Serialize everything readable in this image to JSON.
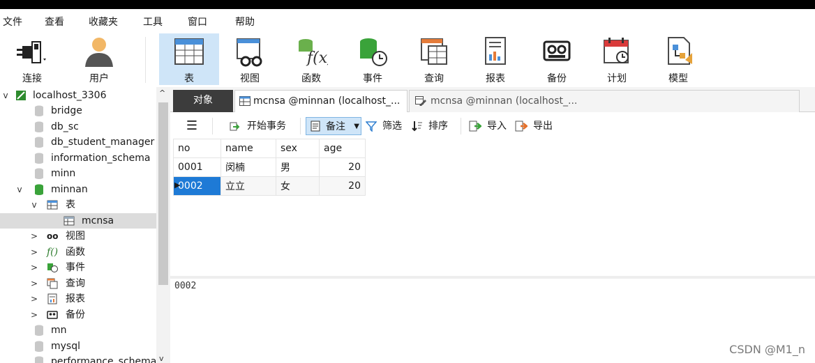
{
  "menu": [
    "文件",
    "查看",
    "收藏夹",
    "工具",
    "窗口",
    "帮助"
  ],
  "ribbon": {
    "connect": "连接",
    "user": "用户",
    "table": "表",
    "view": "视图",
    "function": "函数",
    "event": "事件",
    "query": "查询",
    "report": "报表",
    "backup": "备份",
    "schedule": "计划",
    "model": "模型"
  },
  "tree": {
    "connection": "localhost_3306",
    "databases": [
      "bridge",
      "db_sc",
      "db_student_manager",
      "information_schema",
      "minn"
    ],
    "open_db": "minnan",
    "tables_label": "表",
    "table": "mcnsa",
    "views": "视图",
    "functions": "函数",
    "events": "事件",
    "queries": "查询",
    "reports": "报表",
    "backups": "备份",
    "more_dbs": [
      "mn",
      "mysql",
      "performance_schema"
    ]
  },
  "tabs": {
    "objects": "对象",
    "tab1": "mcnsa @minnan (localhost_...",
    "tab2": "mcnsa @minnan (localhost_..."
  },
  "toolbar": {
    "begin_tx": "开始事务",
    "memo": "备注",
    "filter": "筛选",
    "sort": "排序",
    "import": "导入",
    "export": "导出"
  },
  "grid": {
    "columns": [
      "no",
      "name",
      "sex",
      "age"
    ],
    "rows": [
      [
        "0001",
        "闵楠",
        "男",
        "20"
      ],
      [
        "0002",
        "立立",
        "女",
        "20"
      ]
    ]
  },
  "detail_value": "0002",
  "watermark": "CSDN @M1_n",
  "colors": {
    "selection": "#1e7ad6",
    "ribbon_active": "#cfe5f8",
    "db_green": "#3aa33a"
  }
}
